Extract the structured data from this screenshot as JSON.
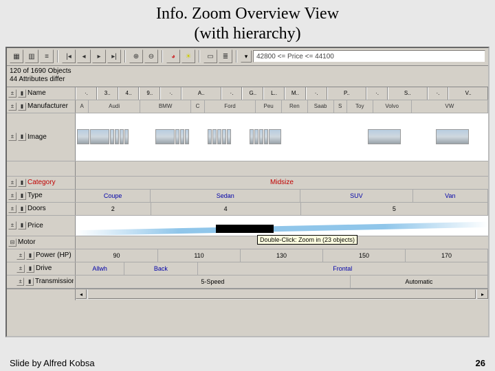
{
  "slide_title_line1": "Info. Zoom Overview View",
  "slide_title_line2": "(with hierarchy)",
  "filter_text": "42800 <= Price <= 44100",
  "status_line1": "120 of 1690 Objects",
  "status_line2": "44 Attributes differ",
  "attrs": {
    "name": "Name",
    "manufacturer": "Manufacturer",
    "image": "Image",
    "category": "Category",
    "type": "Type",
    "doors": "Doors",
    "price": "Price",
    "motor": "Motor",
    "power": "Power (HP)",
    "drive": "Drive",
    "transmission": "Transmission"
  },
  "name_groups": [
    "·.",
    "3..",
    "4..",
    "9..",
    "·.",
    "A..",
    "·.",
    "G..",
    "L..",
    "M..",
    "·.",
    "P..",
    "·.",
    "S..",
    "·.",
    "V.."
  ],
  "manufacturers": [
    "A",
    "Audi",
    "BMW",
    "C",
    "Ford",
    "Peu",
    "Ren",
    "Saab",
    "S",
    "Toy",
    "Volvo",
    "VW"
  ],
  "category_value": "Midsize",
  "types": [
    "Coupe",
    "Sedan",
    "SUV",
    "Van"
  ],
  "doors": [
    "2",
    "4",
    "5"
  ],
  "power_ticks": [
    "90",
    "110",
    "130",
    "150",
    "170"
  ],
  "drive": [
    "Allwh",
    "Back",
    "Frontal"
  ],
  "transmission": [
    "5-Speed",
    "Automatic"
  ],
  "tooltip_text": "Double-Click: Zoom in (23 objects)",
  "footer_credit": "Slide by Alfred Kobsa",
  "footer_page": "26"
}
